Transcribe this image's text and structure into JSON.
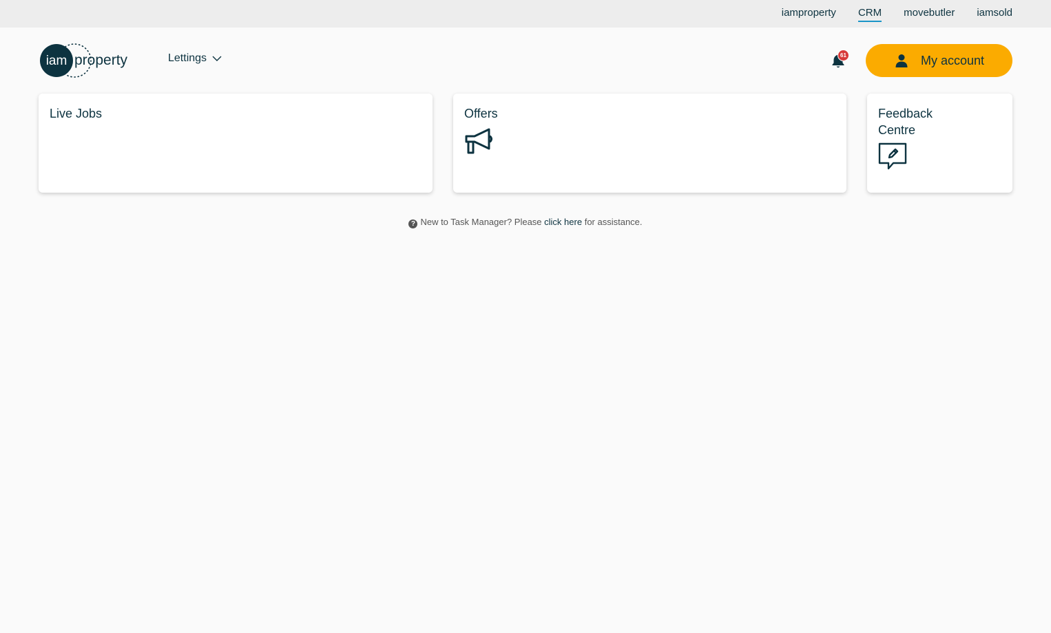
{
  "brand_bar": {
    "links": [
      {
        "label": "iamproperty",
        "active": false
      },
      {
        "label": "CRM",
        "active": true
      },
      {
        "label": "movebutler",
        "active": false
      },
      {
        "label": "iamsold",
        "active": false
      }
    ],
    "active_underline_color": "#1a95c8"
  },
  "header": {
    "logo": {
      "circle_text": "iam",
      "text": "property"
    },
    "department_menu": {
      "label": "Lettings",
      "icon": "chevron-down-icon"
    },
    "notifications": {
      "icon": "bell-icon",
      "count": "61"
    },
    "account_button": {
      "label": "My account",
      "icon": "person-icon",
      "color": "#fbab00"
    }
  },
  "cards": {
    "live_jobs": {
      "title": "Live Jobs"
    },
    "offers": {
      "title": "Offers",
      "icon": "megaphone-icon"
    },
    "feedback": {
      "title": "Feedback Centre",
      "icon": "feedback-edit-icon"
    }
  },
  "help": {
    "prefix": "New to Task Manager? Please",
    "link_label": "click here",
    "suffix": "for assistance.",
    "icon": "question-circle-icon"
  },
  "colors": {
    "primary_text": "#0d3340",
    "page_background": "#fafafa",
    "badge": "#d73a3a"
  }
}
